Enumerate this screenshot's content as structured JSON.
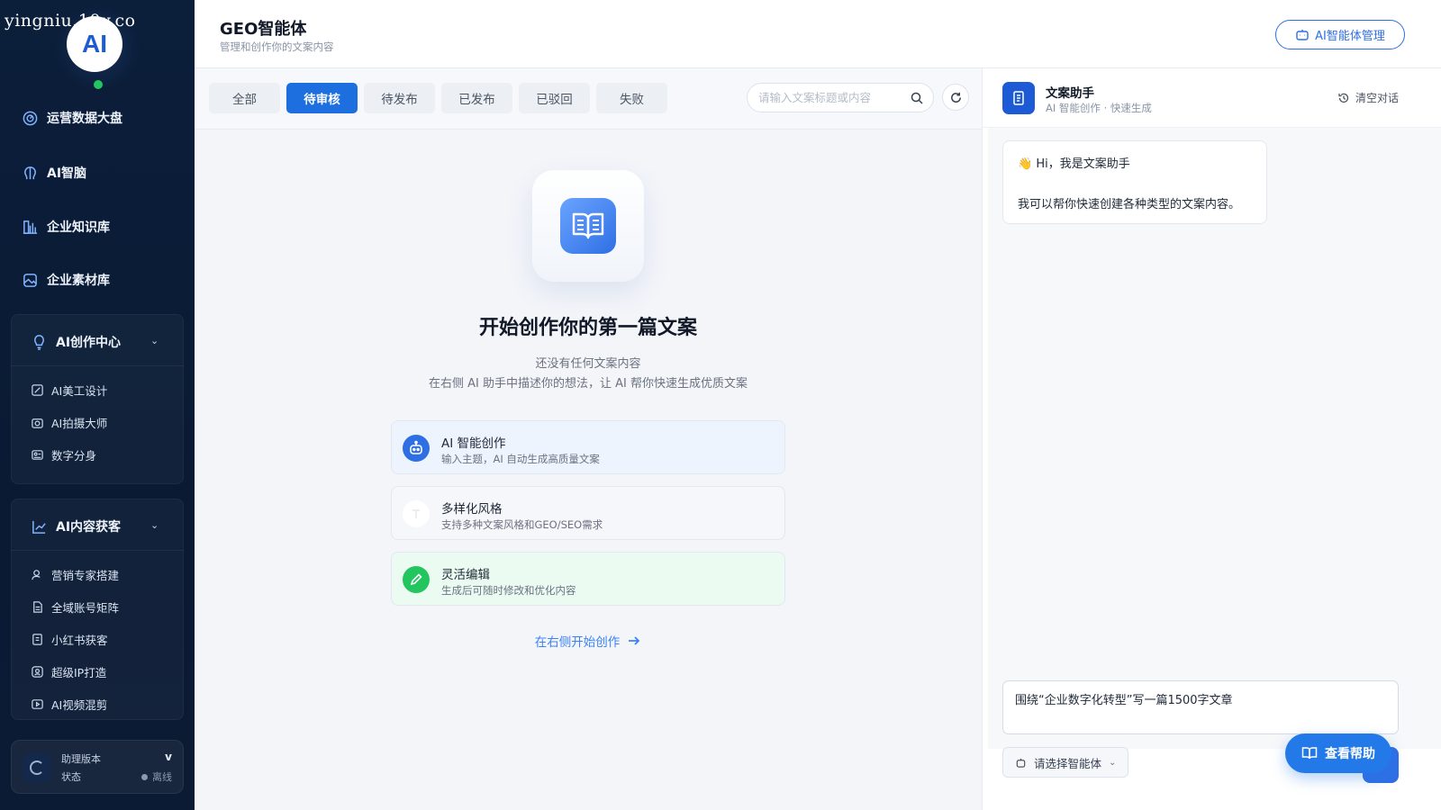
{
  "watermark": "yingniu.10v.co",
  "logo_text": "AI",
  "sidebar": {
    "items": [
      {
        "label": "运营数据大盘",
        "icon": "dashboard-icon"
      },
      {
        "label": "AI智脑",
        "icon": "brain-icon"
      },
      {
        "label": "企业知识库",
        "icon": "library-icon"
      },
      {
        "label": "企业素材库",
        "icon": "image-icon"
      }
    ],
    "group_creation": {
      "label": "AI创作中心",
      "icon": "bulb-icon",
      "items": [
        {
          "label": "AI美工设计",
          "icon": "design-icon"
        },
        {
          "label": "AI拍摄大师",
          "icon": "camera-icon"
        },
        {
          "label": "数字分身",
          "icon": "id-card-icon"
        }
      ]
    },
    "group_content": {
      "label": "AI内容获客",
      "icon": "chart-icon",
      "items": [
        {
          "label": "营销专家搭建",
          "icon": "user-icon"
        },
        {
          "label": "全域账号矩阵",
          "icon": "file-icon"
        },
        {
          "label": "小红书获客",
          "icon": "ai-doc-icon"
        },
        {
          "label": "超级IP打造",
          "icon": "badge-icon"
        },
        {
          "label": "AI视频混剪",
          "icon": "video-icon"
        }
      ]
    },
    "version": {
      "label": "助理版本",
      "value": "v",
      "status_label": "状态",
      "status_value": "离线"
    }
  },
  "header": {
    "title": "GEO智能体",
    "subtitle": "管理和创作你的文案内容",
    "agent_button": "AI智能体管理"
  },
  "tabs": [
    {
      "label": "全部",
      "active": false
    },
    {
      "label": "待审核",
      "active": true
    },
    {
      "label": "待发布",
      "active": false
    },
    {
      "label": "已发布",
      "active": false
    },
    {
      "label": "已驳回",
      "active": false
    },
    {
      "label": "失败",
      "active": false
    }
  ],
  "search": {
    "placeholder": "请输入文案标题或内容",
    "value": ""
  },
  "empty": {
    "title": "开始创作你的第一篇文案",
    "desc1": "还没有任何文案内容",
    "desc2": "在右侧 AI 助手中描述你的想法，让 AI 帮你快速生成优质文案",
    "features": [
      {
        "title": "AI 智能创作",
        "desc": "输入主题，AI 自动生成高质量文案",
        "icon": "robot-icon",
        "color": "#2f6fe4"
      },
      {
        "title": "多样化风格",
        "desc": "支持多种文案风格和GEO/SEO需求",
        "icon": "text-icon",
        "color": "#ffffff"
      },
      {
        "title": "灵活编辑",
        "desc": "生成后可随时修改和优化内容",
        "icon": "pencil-icon",
        "color": "#22c55e"
      }
    ],
    "start_link": "在右侧开始创作"
  },
  "assistant": {
    "name": "文案助手",
    "subtitle": "AI 智能创作 · 快速生成",
    "clear_label": "清空对话",
    "greeting": "👋 Hi，我是文案助手",
    "greeting_body": "我可以帮你快速创建各种类型的文案内容。",
    "input_value": "围绕“企业数字化转型”写一篇1500字文章",
    "agent_select": "请选择智能体",
    "help_button": "查看帮助"
  },
  "colors": {
    "accent": "#1d6fe0",
    "sidebar_bg": "#0b1e3a",
    "success": "#22c55e"
  }
}
